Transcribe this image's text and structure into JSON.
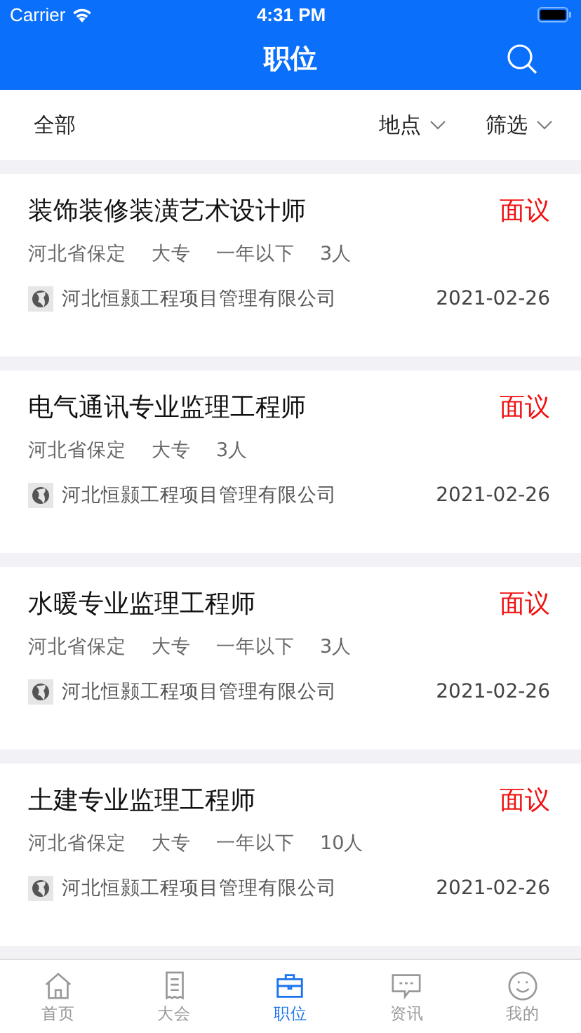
{
  "status_bar": {
    "carrier": "Carrier",
    "time": "4:31 PM"
  },
  "nav": {
    "title": "职位"
  },
  "filters": {
    "all": "全部",
    "dropdowns": [
      "地点",
      "筛选"
    ]
  },
  "jobs": [
    {
      "title": "装饰装修装潢艺术设计师",
      "salary": "面议",
      "tags": [
        "河北省保定",
        "大专",
        "一年以下",
        "3人"
      ],
      "company": "河北恒颢工程项目管理有限公司",
      "date": "2021-02-26"
    },
    {
      "title": "电气通讯专业监理工程师",
      "salary": "面议",
      "tags": [
        "河北省保定",
        "大专",
        "3人"
      ],
      "company": "河北恒颢工程项目管理有限公司",
      "date": "2021-02-26"
    },
    {
      "title": "水暖专业监理工程师",
      "salary": "面议",
      "tags": [
        "河北省保定",
        "大专",
        "一年以下",
        "3人"
      ],
      "company": "河北恒颢工程项目管理有限公司",
      "date": "2021-02-26"
    },
    {
      "title": "土建专业监理工程师",
      "salary": "面议",
      "tags": [
        "河北省保定",
        "大专",
        "一年以下",
        "10人"
      ],
      "company": "河北恒颢工程项目管理有限公司",
      "date": "2021-02-26"
    }
  ],
  "tabs": [
    {
      "label": "首页",
      "kind": "home",
      "selected": false
    },
    {
      "label": "大会",
      "kind": "doc",
      "selected": false
    },
    {
      "label": "职位",
      "kind": "briefcase",
      "selected": true
    },
    {
      "label": "资讯",
      "kind": "chat",
      "selected": false
    },
    {
      "label": "我的",
      "kind": "smile",
      "selected": false
    }
  ]
}
